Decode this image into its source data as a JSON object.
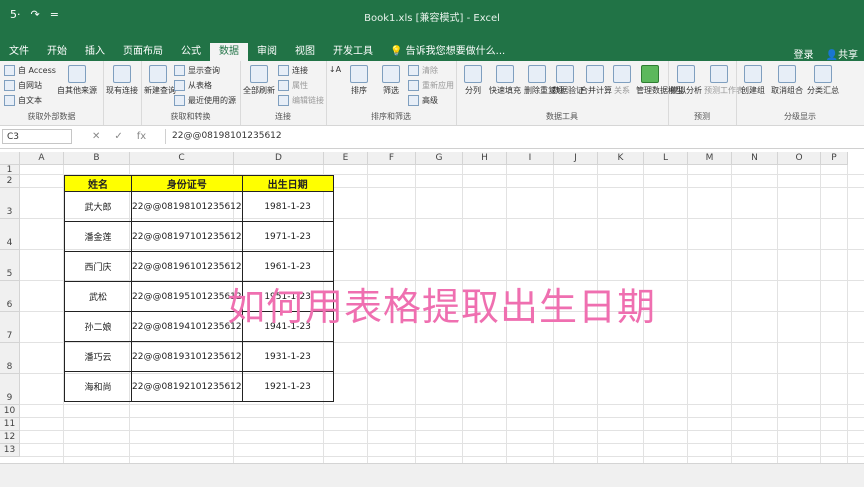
{
  "window": {
    "title": "Book1.xls  [兼容模式] - Excel",
    "qat_undo": "5·",
    "qat_redo": "↷",
    "qat_more": "="
  },
  "tabs": [
    "文件",
    "开始",
    "插入",
    "页面布局",
    "公式",
    "数据",
    "审阅",
    "视图",
    "开发工具"
  ],
  "active_tab": "数据",
  "tell_me": "告诉我您想要做什么...",
  "account": {
    "login": "登录",
    "share": "共享"
  },
  "ribbon": {
    "get_external": {
      "label": "获取外部数据",
      "access": "自 Access",
      "web": "自网站",
      "text": "自文本",
      "other": "自其他来源",
      "existing": "现有连接"
    },
    "get_transform": {
      "label": "获取和转换",
      "new_query": "新建查询",
      "show_queries": "显示查询",
      "from_table": "从表格",
      "recent": "最近使用的源"
    },
    "connections": {
      "label": "连接",
      "refresh_all": "全部刷新",
      "connections": "连接",
      "properties": "属性",
      "edit_links": "编辑链接"
    },
    "sort_filter": {
      "label": "排序和筛选",
      "sort": "排序",
      "filter": "筛选",
      "clear": "清除",
      "reapply": "重新应用",
      "advanced": "高级"
    },
    "data_tools": {
      "label": "数据工具",
      "split": "分列",
      "flash_fill": "快速填充",
      "remove_dup": "删除重复项",
      "validation": "数据验证",
      "consolidate": "合并计算",
      "relationships": "关系",
      "data_model": "管理数据模型"
    },
    "forecast": {
      "label": "预测",
      "what_if": "模拟分析",
      "forecast_sheet": "预测工作表"
    },
    "outline": {
      "label": "分级显示",
      "group": "创建组",
      "ungroup": "取消组合",
      "subtotal": "分类汇总"
    }
  },
  "formula_bar": {
    "name_box": "C3",
    "formula": "22@@08198101235612",
    "fx": "fx"
  },
  "columns": [
    "A",
    "B",
    "C",
    "D",
    "E",
    "F",
    "G",
    "H",
    "I",
    "J",
    "K",
    "L",
    "M",
    "N",
    "O",
    "P"
  ],
  "rows": [
    "1",
    "2",
    "3",
    "4",
    "5",
    "6",
    "7",
    "8",
    "9",
    "10",
    "11",
    "12",
    "13"
  ],
  "table": {
    "headers": [
      "姓名",
      "身份证号",
      "出生日期"
    ],
    "rows": [
      [
        "武大郎",
        "22@@08198101235612",
        "1981-1-23"
      ],
      [
        "潘金莲",
        "22@@08197101235612",
        "1971-1-23"
      ],
      [
        "西门庆",
        "22@@08196101235612",
        "1961-1-23"
      ],
      [
        "武松",
        "22@@08195101235612",
        "1951-1-23"
      ],
      [
        "孙二娘",
        "22@@08194101235612",
        "1941-1-23"
      ],
      [
        "潘巧云",
        "22@@08193101235612",
        "1931-1-23"
      ],
      [
        "海和尚",
        "22@@08192101235612",
        "1921-1-23"
      ]
    ]
  },
  "overlay_caption": "如何用表格提取出生日期",
  "colors": {
    "excel_green": "#217346",
    "header_fill": "#ffff00",
    "caption": "#ef6fb0"
  }
}
